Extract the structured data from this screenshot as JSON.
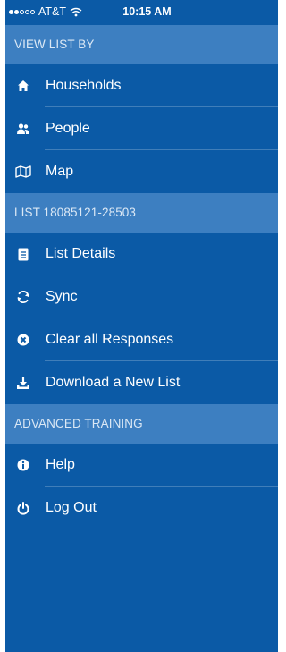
{
  "status_bar": {
    "carrier": "AT&T",
    "time": "10:15 AM"
  },
  "colors": {
    "background": "#0b5aa6",
    "section_header": "#3d7fc1"
  },
  "sections": [
    {
      "header": "VIEW LIST BY",
      "items": [
        {
          "label": "Households",
          "icon": "house-icon"
        },
        {
          "label": "People",
          "icon": "people-icon"
        },
        {
          "label": "Map",
          "icon": "map-icon"
        }
      ]
    },
    {
      "header": "LIST 18085121-28503",
      "items": [
        {
          "label": "List Details",
          "icon": "document-icon"
        },
        {
          "label": "Sync",
          "icon": "sync-icon"
        },
        {
          "label": "Clear all Responses",
          "icon": "clear-icon"
        },
        {
          "label": "Download a New List",
          "icon": "download-icon"
        }
      ]
    },
    {
      "header": "ADVANCED TRAINING",
      "items": [
        {
          "label": "Help",
          "icon": "info-icon"
        },
        {
          "label": "Log Out",
          "icon": "power-icon"
        }
      ]
    }
  ]
}
